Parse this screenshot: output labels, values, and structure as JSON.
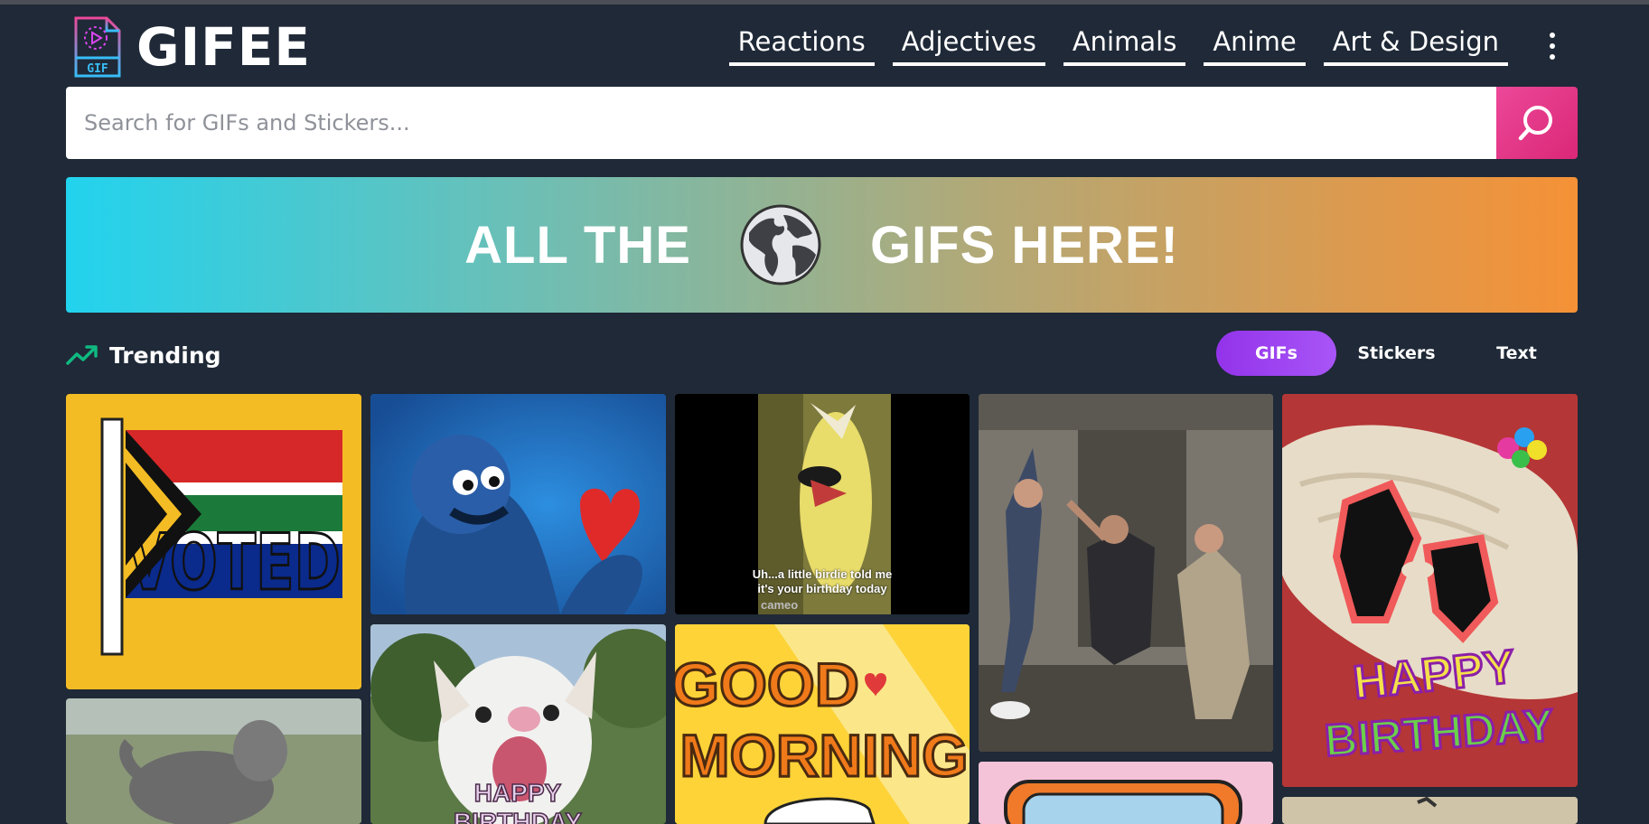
{
  "brand": {
    "name": "GIFEE",
    "logo_badge": "GIF"
  },
  "nav": {
    "items": [
      "Reactions",
      "Adjectives",
      "Animals",
      "Anime",
      "Art & Design"
    ],
    "more_icon": "vertical-ellipsis-icon"
  },
  "search": {
    "value": "",
    "placeholder": "Search for GIFs and Stickers...",
    "button_icon": "search-icon",
    "button_color": "#ec4899"
  },
  "banner": {
    "left_text": "ALL THE",
    "right_text": "GIFS HERE!",
    "icon": "globe-icon",
    "gradient": [
      "#22d3ee",
      "#f59136"
    ]
  },
  "trending": {
    "label": "Trending",
    "icon": "trending-up-icon",
    "icon_color": "#10b981"
  },
  "filters": {
    "items": [
      "GIFs",
      "Stickers",
      "Text"
    ],
    "active": "GIFs",
    "active_color": "#9333ea"
  },
  "gifs": {
    "voted": {
      "text": "VOTED"
    },
    "birdie": {
      "caption_line1": "Uh...a little birdie told me",
      "caption_line2": "it's your birthday today",
      "watermark": "cameo"
    },
    "good_morning": {
      "line1": "GOOD",
      "line2": "MORNING"
    },
    "goat": {
      "text_line1": "HAPPY",
      "text_line2": "BIRTHDAY"
    },
    "dog": {
      "text_line1": "HAPPY",
      "text_line2": "BIRTHDAY"
    }
  },
  "colors": {
    "background": "#1f2937",
    "text": "#ffffff"
  }
}
